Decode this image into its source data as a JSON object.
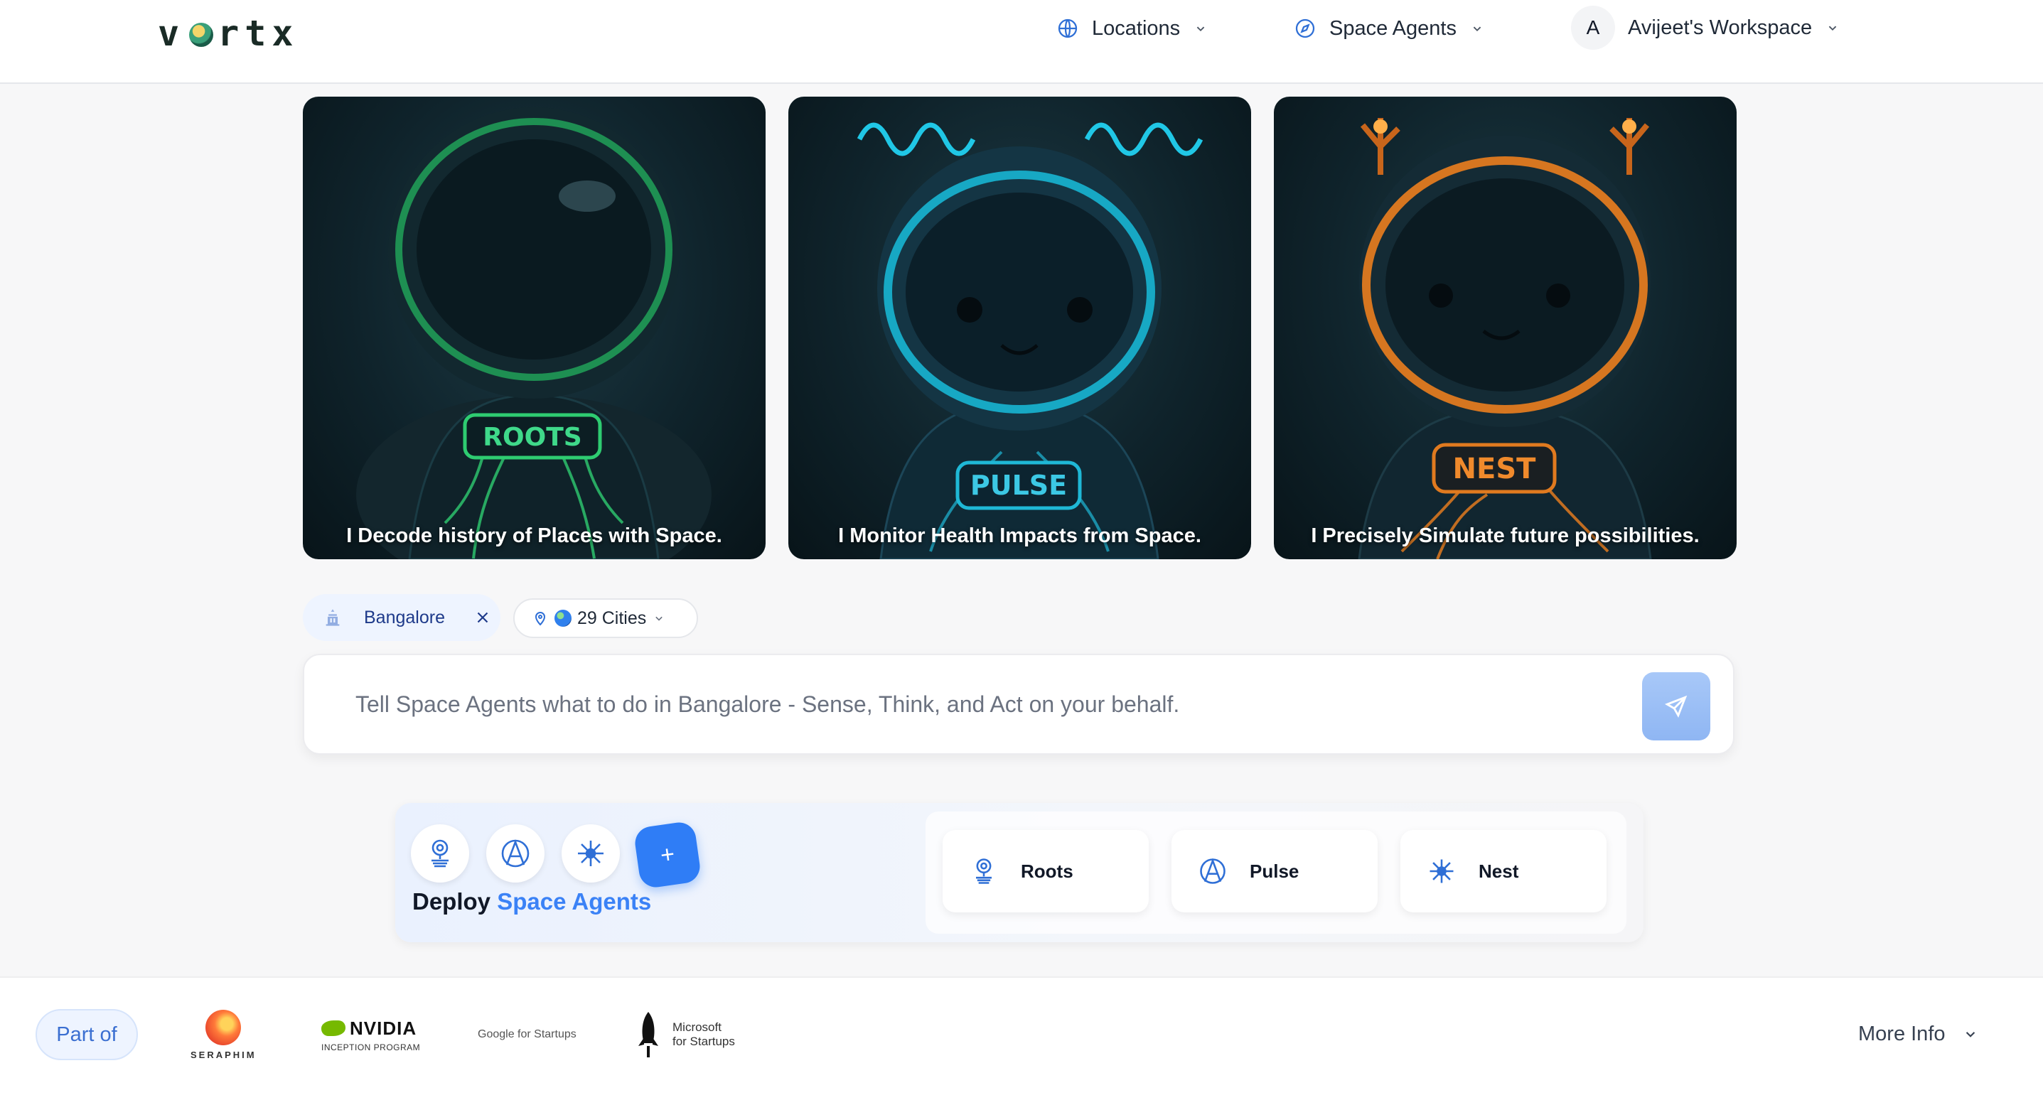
{
  "header": {
    "logo": "vortx",
    "nav": [
      {
        "label": "Locations",
        "icon": "globe-icon"
      },
      {
        "label": "Space Agents",
        "icon": "compass-icon"
      }
    ],
    "workspace": {
      "avatar_initial": "A",
      "label": "Avijeet's Workspace"
    }
  },
  "cards": [
    {
      "badge": "ROOTS",
      "caption": "I Decode history of Places with Space.",
      "accent": "#2ecc71"
    },
    {
      "badge": "PULSE",
      "caption": "I Monitor Health Impacts from Space.",
      "accent": "#1fb8d6"
    },
    {
      "badge": "NEST",
      "caption": "I Precisely Simulate future possibilities.",
      "accent": "#e07a1f"
    }
  ],
  "location_chip": {
    "label": "Bangalore"
  },
  "cities_chip": {
    "label": "29 Cities"
  },
  "prompt": {
    "placeholder": "Tell Space Agents what to do in Bangalore - Sense, Think, and Act on your behalf."
  },
  "deploy": {
    "title_prefix": "Deploy",
    "title_accent": "Space Agents",
    "add_symbol": "+",
    "agents": [
      {
        "label": "Roots",
        "icon": "roots-agent-icon"
      },
      {
        "label": "Pulse",
        "icon": "pulse-agent-icon"
      },
      {
        "label": "Nest",
        "icon": "nest-agent-icon"
      }
    ]
  },
  "footer": {
    "part_of": "Part of",
    "partners": {
      "seraphim": "SERAPHIM",
      "nvidia": "NVIDIA",
      "nvidia_sub": "INCEPTION PROGRAM",
      "google": "Google for Startups",
      "microsoft_line1": "Microsoft",
      "microsoft_line2": "for Startups"
    },
    "more_info": "More Info"
  },
  "colors": {
    "accent_blue": "#3b82f6",
    "send_button": "#9bbcf5"
  }
}
